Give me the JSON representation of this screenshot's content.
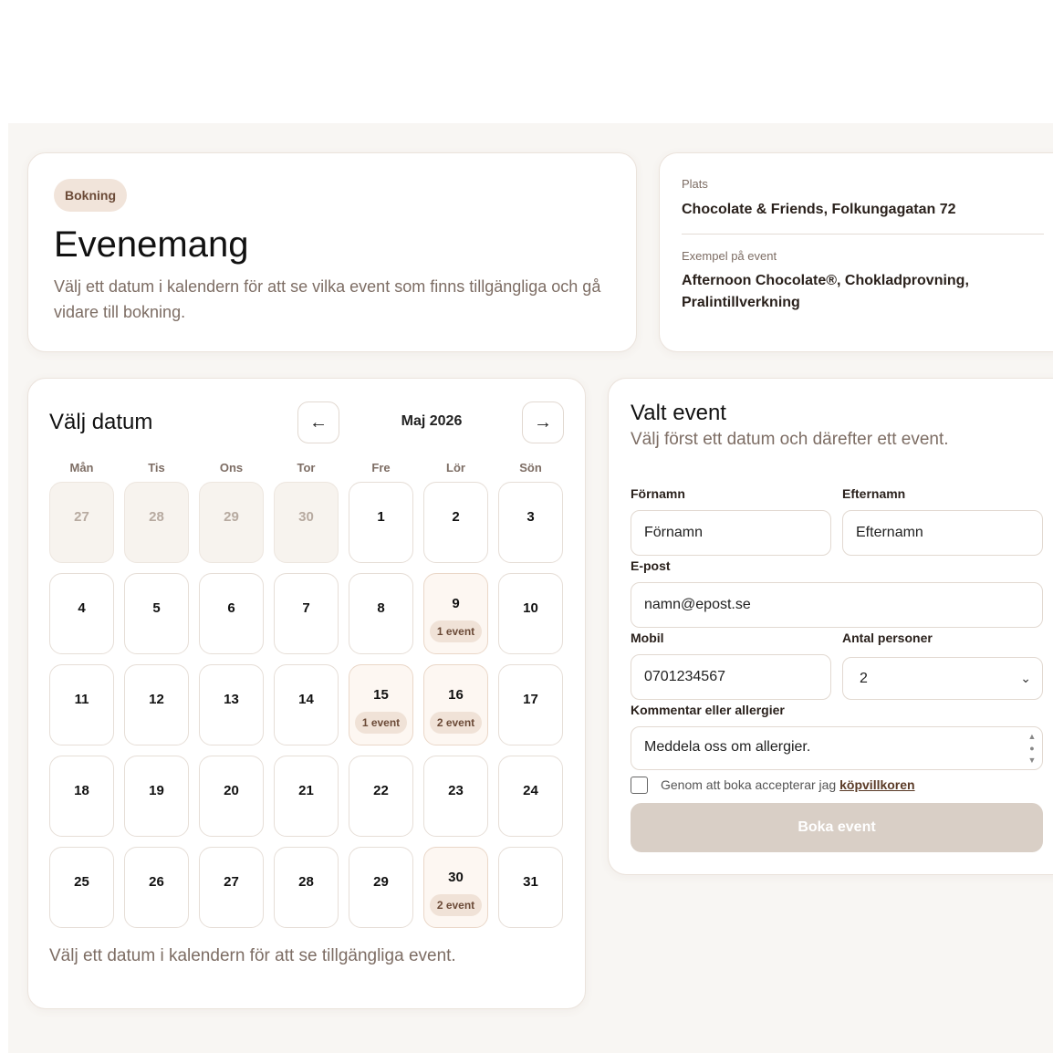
{
  "intro": {
    "badge": "Bokning",
    "title": "Evenemang",
    "description": "Välj ett datum i kalendern för att se vilka event som finns tillgängliga och gå vidare till bokning."
  },
  "info": {
    "place_label": "Plats",
    "place_value": "Chocolate & Friends, Folkungagatan 72",
    "example_label": "Exempel på event",
    "example_value": "Afternoon Chocolate®, Chokladprovning, Pralintillverkning"
  },
  "calendar": {
    "title": "Välj datum",
    "prev_icon": "←",
    "next_icon": "→",
    "month": "Maj 2026",
    "weekdays": [
      "Mån",
      "Tis",
      "Ons",
      "Tor",
      "Fre",
      "Lör",
      "Sön"
    ],
    "days": [
      {
        "n": "27",
        "muted": true
      },
      {
        "n": "28",
        "muted": true
      },
      {
        "n": "29",
        "muted": true
      },
      {
        "n": "30",
        "muted": true
      },
      {
        "n": "1"
      },
      {
        "n": "2"
      },
      {
        "n": "3"
      },
      {
        "n": "4"
      },
      {
        "n": "5"
      },
      {
        "n": "6"
      },
      {
        "n": "7"
      },
      {
        "n": "8"
      },
      {
        "n": "9",
        "events": "1 event"
      },
      {
        "n": "10"
      },
      {
        "n": "11"
      },
      {
        "n": "12"
      },
      {
        "n": "13"
      },
      {
        "n": "14"
      },
      {
        "n": "15",
        "events": "1 event"
      },
      {
        "n": "16",
        "events": "2 event"
      },
      {
        "n": "17"
      },
      {
        "n": "18"
      },
      {
        "n": "19"
      },
      {
        "n": "20"
      },
      {
        "n": "21"
      },
      {
        "n": "22"
      },
      {
        "n": "23"
      },
      {
        "n": "24"
      },
      {
        "n": "25"
      },
      {
        "n": "26"
      },
      {
        "n": "27"
      },
      {
        "n": "28"
      },
      {
        "n": "29"
      },
      {
        "n": "30",
        "events": "2 event"
      },
      {
        "n": "31"
      }
    ],
    "hint": "Välj ett datum i kalendern för att se tillgängliga event."
  },
  "form": {
    "title": "Valt event",
    "subtitle": "Välj först ett datum och därefter ett event.",
    "first_name_label": "Förnamn",
    "first_name_placeholder": "Förnamn",
    "last_name_label": "Efternamn",
    "last_name_placeholder": "Efternamn",
    "email_label": "E-post",
    "email_placeholder": "namn@epost.se",
    "mobile_label": "Mobil",
    "mobile_placeholder": "0701234567",
    "persons_label": "Antal personer",
    "persons_value": "2",
    "comment_label": "Kommentar eller allergier",
    "comment_placeholder": "Meddela oss om allergier.",
    "terms_text": "Genom att boka accepterar jag",
    "terms_link": "köpvillkoren",
    "submit_label": "Boka event"
  },
  "colors": {
    "background": "#f8f6f3",
    "accent_badge": "#f1e4da",
    "event_day": "#fdf7f2",
    "submit_disabled": "#d9cfc6"
  }
}
